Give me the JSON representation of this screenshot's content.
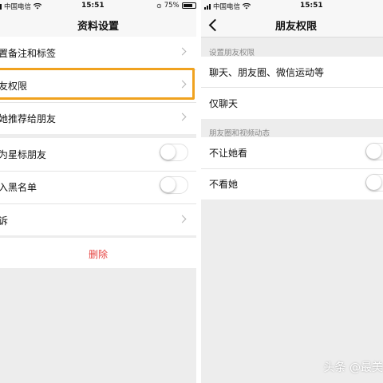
{
  "left_screen": {
    "status": {
      "carrier": "中国电信",
      "time": "15:51",
      "battery": "75%"
    },
    "nav_title": "资料设置",
    "rows": [
      {
        "label": "置备注和标签"
      },
      {
        "label": "友权限"
      },
      {
        "label": "她推荐给朋友"
      },
      {
        "label": "为星标朋友",
        "toggle": false
      },
      {
        "label": "入黑名单",
        "toggle": false
      },
      {
        "label": "诉"
      }
    ],
    "delete_label": "删除"
  },
  "right_screen": {
    "status": {
      "carrier": "中国电信",
      "time": "15:51"
    },
    "nav_title": "朋友权限",
    "section_headers": [
      "设置朋友权限",
      "朋友圈和视频动态"
    ],
    "permission_options": [
      "聊天、朋友圈、微信运动等",
      "仅聊天"
    ],
    "moments_options": [
      {
        "label": "不让她看",
        "toggle": false
      },
      {
        "label": "不看她",
        "toggle": false
      }
    ]
  },
  "watermark": "头条 @最美",
  "colors": {
    "highlight": "#f0a21f",
    "danger": "#e64340",
    "background": "#ededed",
    "cell": "#ffffff"
  },
  "icons": [
    "wifi-icon",
    "signal-icon",
    "battery-icon",
    "location-icon",
    "back-chevron-icon",
    "chevron-right-icon"
  ]
}
